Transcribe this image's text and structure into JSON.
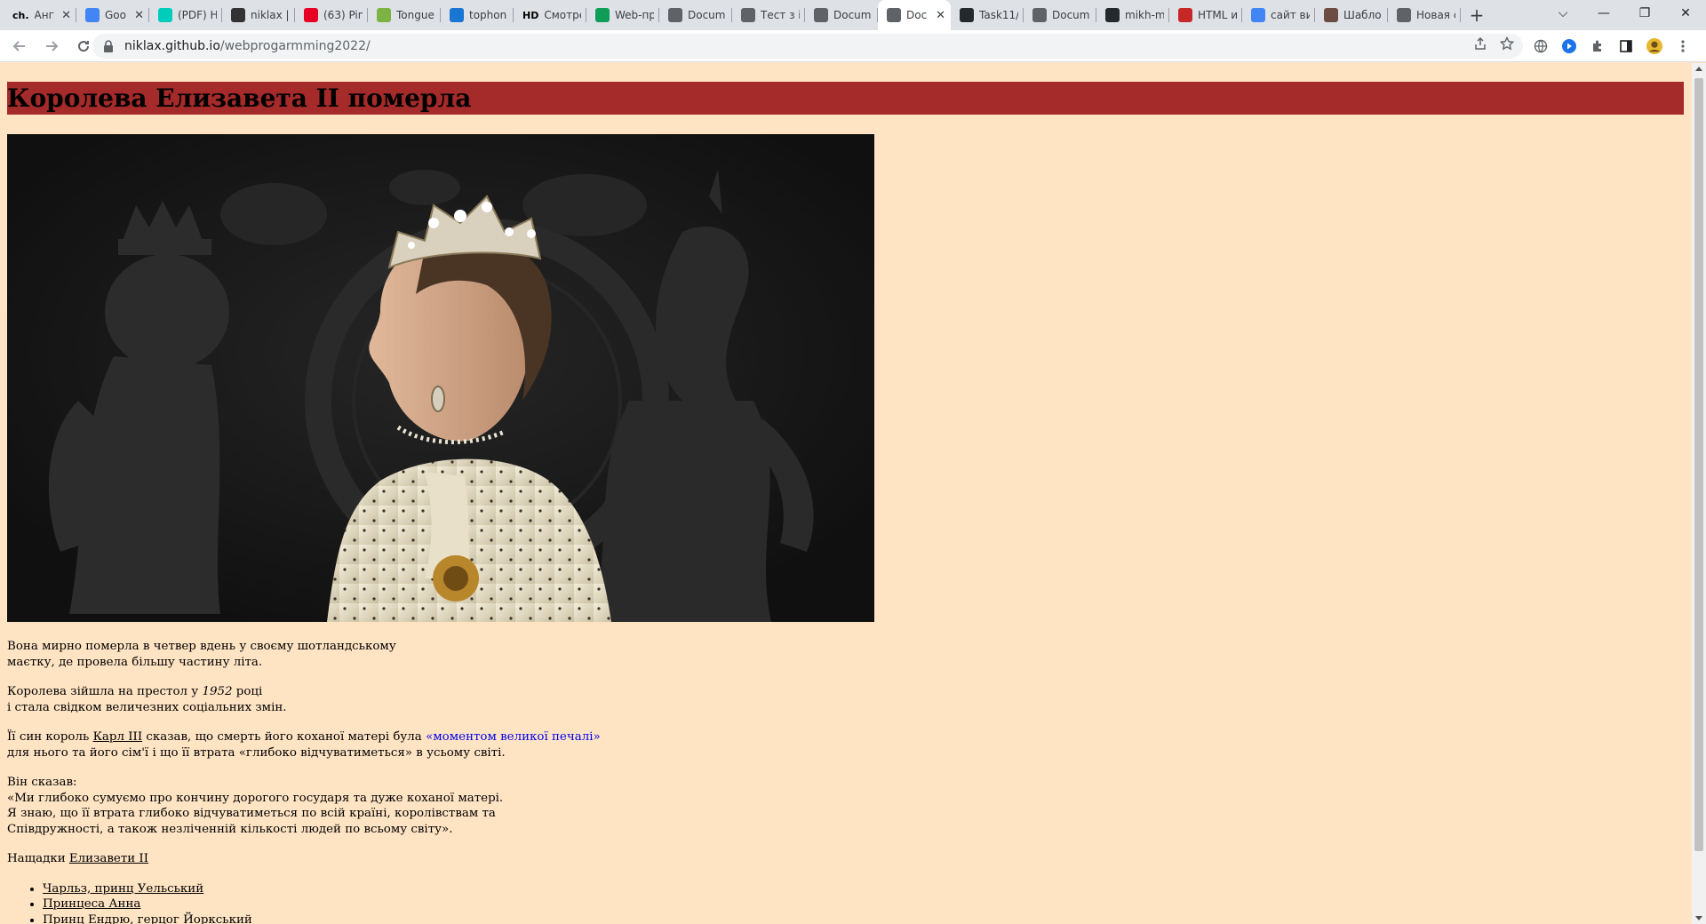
{
  "browser": {
    "tabs": [
      {
        "label": "Анг",
        "icon": "dictionary-icon",
        "prefix": "ch.",
        "color": "#ffffff",
        "text_color": "#000000",
        "has_close": true
      },
      {
        "label": "Goo",
        "icon": "google-docs-icon",
        "color": "#4285f4",
        "has_close": true
      },
      {
        "label": "(PDF) H",
        "icon": "researchgate-icon",
        "color": "#00ccbb",
        "has_close": false
      },
      {
        "label": "niklax |",
        "icon": "document-icon",
        "color": "#333333",
        "has_close": false
      },
      {
        "label": "(63) Pin",
        "icon": "pinterest-icon",
        "color": "#e60023",
        "has_close": false
      },
      {
        "label": "Tongue",
        "icon": "app-icon",
        "color": "#7cb342",
        "has_close": false
      },
      {
        "label": "tophon",
        "icon": "chart-icon",
        "color": "#1976d2",
        "has_close": false
      },
      {
        "label": "Смотре",
        "icon": "hd-icon",
        "prefix": "HD",
        "color": "#ffffff",
        "text_color": "#000000",
        "has_close": false
      },
      {
        "label": "Web-пр",
        "icon": "sheets-icon",
        "color": "#0f9d58",
        "has_close": false
      },
      {
        "label": "Docum",
        "icon": "globe-icon",
        "color": "#5f6368",
        "has_close": false
      },
      {
        "label": "Тест з і",
        "icon": "globe-icon",
        "color": "#5f6368",
        "has_close": false
      },
      {
        "label": "Docum",
        "icon": "globe-icon",
        "color": "#5f6368",
        "has_close": false
      },
      {
        "label": "Doc",
        "icon": "globe-icon",
        "color": "#5f6368",
        "has_close": true,
        "active": true
      },
      {
        "label": "Task11/",
        "icon": "github-icon",
        "color": "#24292e",
        "has_close": false
      },
      {
        "label": "Docum",
        "icon": "globe-icon",
        "color": "#5f6368",
        "has_close": false
      },
      {
        "label": "mikh-m",
        "icon": "github-icon",
        "color": "#24292e",
        "has_close": false
      },
      {
        "label": "HTML и",
        "icon": "html-book-icon",
        "color": "#c62828",
        "has_close": false
      },
      {
        "label": "сайт ви",
        "icon": "google-icon",
        "color": "#4285f4",
        "has_close": false
      },
      {
        "label": "Шабло",
        "icon": "site-icon",
        "color": "#6d4c41",
        "has_close": false
      },
      {
        "label": "Новая с",
        "icon": "chrome-icon",
        "color": "#5f6368",
        "has_close": false
      }
    ],
    "new_tab_label": "+",
    "url_host": "niklax.github.io",
    "url_path": "/webprogarmming2022/"
  },
  "article": {
    "headline": "Королева Елизавета II померла",
    "p1_line1": "Вона мирно померла в четвер вдень у своєму шотландському",
    "p1_line2": "маєтку, де провела більшу частину літа.",
    "p2_before": "Королева зійшла на престол у ",
    "p2_year": "1952",
    "p2_after": " році",
    "p2_line2": "і стала свідком величезних соціальних змін.",
    "p3_before": "Її син король ",
    "p3_link": "Карл III",
    "p3_middle": " сказав, що смерть його коханої матері була ",
    "p3_quote": "«моментом великої печалі»",
    "p3_line2": "для нього та його сім'ї і що її втрата «глибоко відчуватиметься» в усьому світі.",
    "p4_line1": "Він сказав:",
    "p4_line2": "«Ми глибоко сумуємо про кончину дорогого государя та дуже коханої матері.",
    "p4_line3": "Я знаю, що її втрата глибоко відчуватиметься по всій країні, королівствам та",
    "p4_line4": "Співдружності, а також незліченній кількості людей по всьому світу».",
    "p5_before": "Нащадки ",
    "p5_link": "Елизавети II",
    "descendants": [
      "Чарльз, принц Уельський",
      "Принцеса Анна",
      "Принц Ендрю, герцог Йоркський"
    ]
  },
  "colors": {
    "page_background": "#ffe4c4",
    "headline_background": "#a52a2a",
    "quote_link": "#0000ee"
  }
}
